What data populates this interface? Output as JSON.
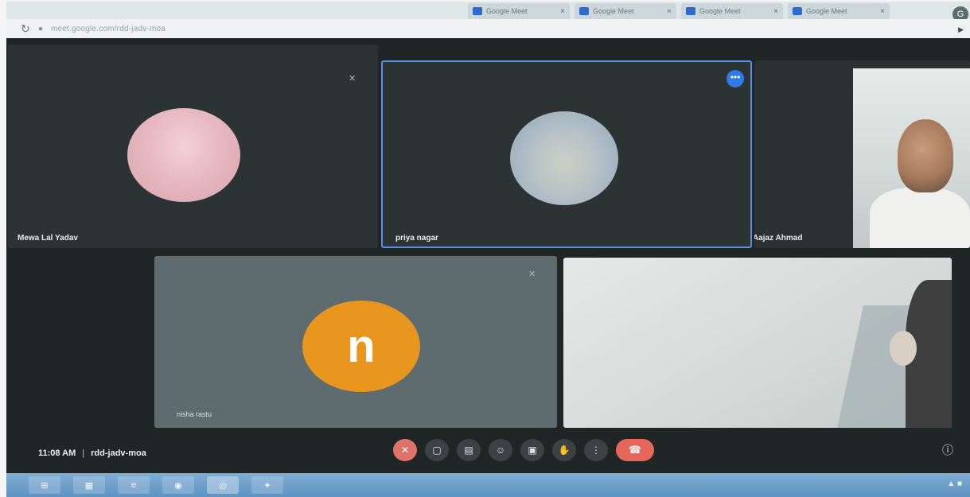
{
  "browser": {
    "tabs": [
      {
        "label": "Google Meet"
      },
      {
        "label": "Google Meet"
      },
      {
        "label": "Google Meet"
      },
      {
        "label": "Google Meet"
      }
    ],
    "tab_close_glyph": "×",
    "url": "meet.google.com/rdd-jadv-moa",
    "reload_glyph": "↻",
    "lock_glyph": "●",
    "profile_glyph": "G",
    "cast_glyph": "▶"
  },
  "participants": {
    "tile1": {
      "name": "Mewa Lal Yadav"
    },
    "tile2": {
      "name": "priya nagar",
      "more_glyph": "•••"
    },
    "tile3": {
      "name": "Aajaz Ahmad"
    },
    "tile4": {
      "name": "nisha rastu",
      "initial": "n",
      "avatar_color": "#e9961f"
    },
    "mic_off_glyph": "✕"
  },
  "meeting": {
    "time": "11:08 AM",
    "separator": "|",
    "code": "rdd-jadv-moa",
    "info_glyph": "ⓘ"
  },
  "controls": [
    {
      "icon": "mic-off-icon",
      "glyph": "✕"
    },
    {
      "icon": "camera-icon",
      "glyph": "▢"
    },
    {
      "icon": "captions-icon",
      "glyph": "▤"
    },
    {
      "icon": "emoji-icon",
      "glyph": "☺"
    },
    {
      "icon": "present-icon",
      "glyph": "▣"
    },
    {
      "icon": "raise-hand-icon",
      "glyph": "✋"
    },
    {
      "icon": "more-options-icon",
      "glyph": "⋮"
    },
    {
      "icon": "end-call-icon",
      "glyph": "☎"
    }
  ],
  "taskbar": {
    "items": [
      {
        "icon": "start-icon",
        "glyph": "⊞"
      },
      {
        "icon": "folder-icon",
        "glyph": "▦"
      },
      {
        "icon": "internet-explorer-icon",
        "glyph": "e"
      },
      {
        "icon": "media-icon",
        "glyph": "◉"
      },
      {
        "icon": "chrome-icon",
        "glyph": "◎"
      },
      {
        "icon": "app-icon",
        "glyph": "✦"
      }
    ],
    "tray_glyph": "▲ ■"
  }
}
